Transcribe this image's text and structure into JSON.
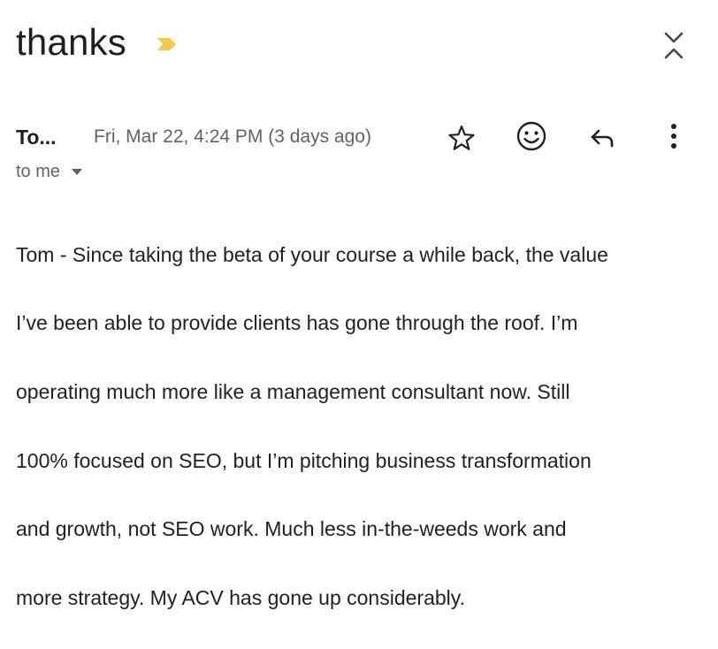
{
  "email": {
    "subject": "thanks",
    "sender_short": "To...",
    "date": "Fri, Mar 22, 4:24 PM (3 days ago)",
    "recipient": "to me",
    "body_lines": [
      "Tom - Since taking the beta of your course a while back, the value",
      "I’ve been able to provide clients has gone through the roof. I’m",
      "operating much more like a management consultant now. Still",
      "100% focused on SEO, but I’m pitching business transformation",
      "and growth, not SEO work. Much less in-the-weeds work and",
      "more strategy. My ACV has gone up considerably."
    ]
  },
  "icons": {
    "important": "important-marker-icon",
    "expand_collapse": "unfold-icon",
    "star": "star-icon",
    "emoji": "emoji-react-icon",
    "reply": "reply-icon",
    "more": "more-vert-icon",
    "recipient_details": "caret-down-icon"
  },
  "colors": {
    "important_marker": "#f2c94c",
    "text_primary": "#202124",
    "text_secondary": "#5f6368"
  }
}
